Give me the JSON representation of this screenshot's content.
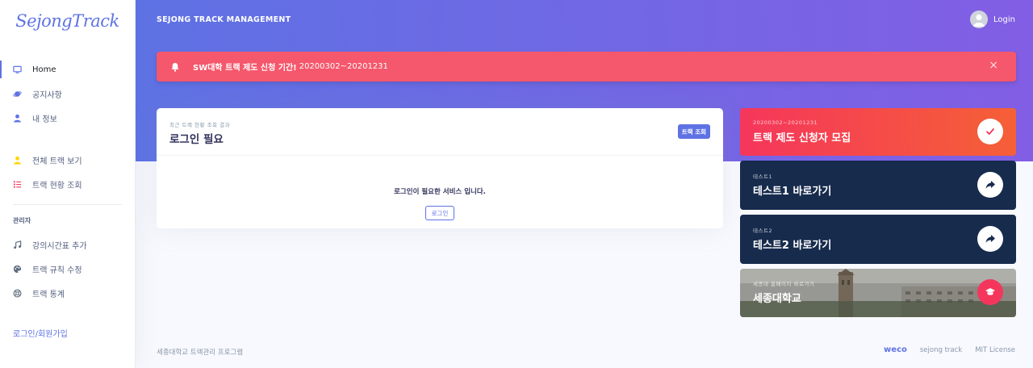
{
  "sidebar": {
    "brand": "SejongTrack",
    "items": [
      {
        "label": "Home",
        "icon": "monitor-icon",
        "color": "#5e72e4"
      },
      {
        "label": "공지사항",
        "icon": "planet-icon",
        "color": "#5e72e4"
      },
      {
        "label": "내 정보",
        "icon": "user-icon",
        "color": "#5e72e4"
      },
      {
        "label": "전체 트랙 보기",
        "icon": "user-icon",
        "color": "#ffd600"
      },
      {
        "label": "트랙 현황 조회",
        "icon": "list-icon",
        "color": "#f5365c"
      }
    ],
    "admin_heading": "관리자",
    "admin_items": [
      {
        "label": "강의시간표 추가",
        "icon": "music-icon",
        "color": "#5f6f81"
      },
      {
        "label": "트랙 규칙 수정",
        "icon": "palette-icon",
        "color": "#5f6f81"
      },
      {
        "label": "트랙 통계",
        "icon": "support-icon",
        "color": "#5f6f81"
      }
    ],
    "login_link": "로그인/회원가입"
  },
  "header": {
    "title": "SEJONG TRACK MANAGEMENT",
    "login": "Login"
  },
  "alert": {
    "bold": "SW대학 트랙 제도 신청 기간!",
    "text": "20200302~20201231",
    "close": "×"
  },
  "main_card": {
    "subtitle": "최근 트랙 현황 조회 결과",
    "title": "로그인 필요",
    "button": "트랙 조회",
    "message": "로그인이 필요한 서비스 입니다.",
    "login_button": "로그인"
  },
  "right_cards": [
    {
      "subtitle": "20200302~20201231",
      "title": "트랙 제도 신청자 모집",
      "icon": "check-icon"
    },
    {
      "subtitle": "테스트1",
      "title": "테스트1 바로가기",
      "icon": "share-arrow-icon"
    },
    {
      "subtitle": "테스트2",
      "title": "테스트2 바로가기",
      "icon": "share-arrow-icon"
    },
    {
      "subtitle": "세종대 홈페이지 바로가기",
      "title": "세종대학교",
      "icon": "graduation-cap-icon"
    }
  ],
  "footer": {
    "left": "세종대학교 트랙관리 프로그램",
    "brand": "weco",
    "link1": "sejong track",
    "link2": "MIT License"
  },
  "colors": {
    "primary": "#5e72e4",
    "danger": "#f5365c",
    "alert": "#f5576c",
    "dark": "#172b4d"
  }
}
